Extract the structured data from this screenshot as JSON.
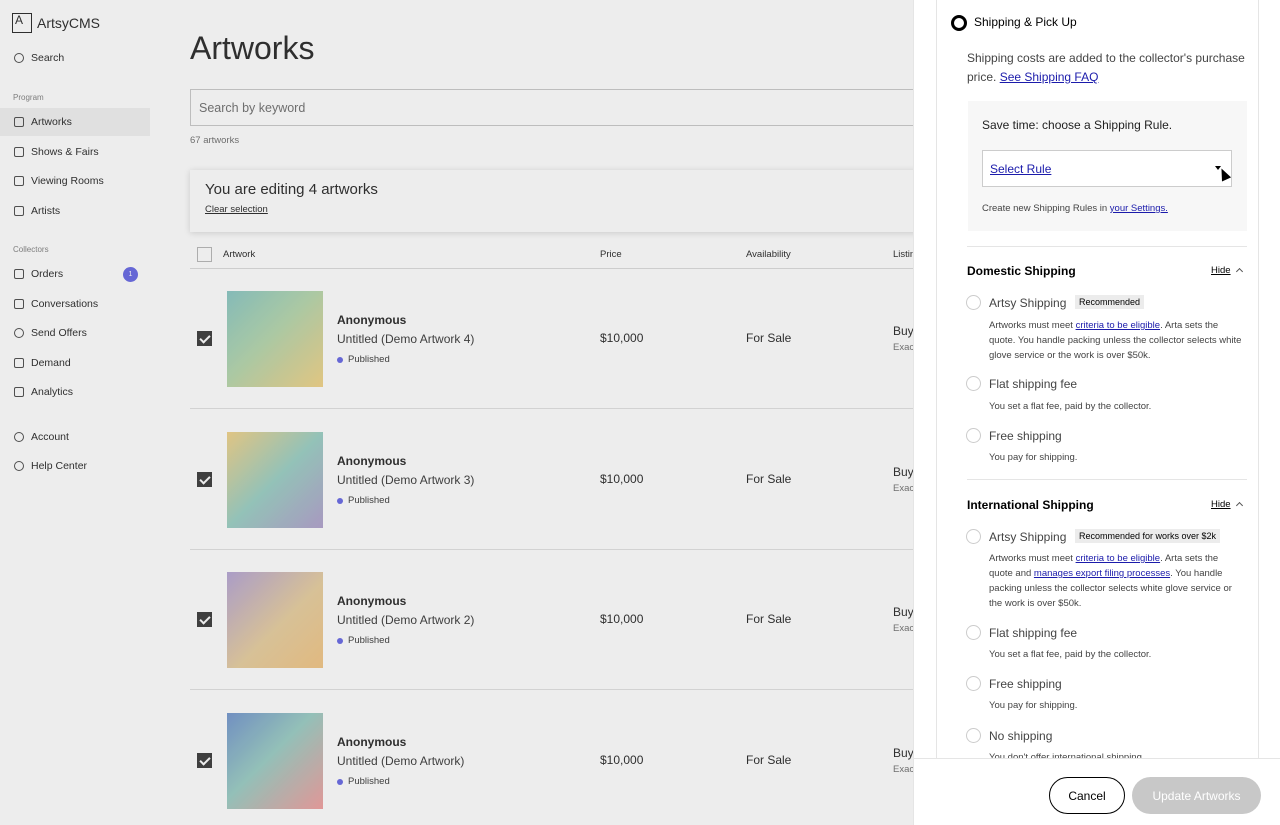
{
  "app": {
    "logo_text": "ArtsyCMS",
    "sidebar": {
      "search": "Search",
      "program_label": "Program",
      "program_items": [
        "Artworks",
        "Shows & Fairs",
        "Viewing Rooms",
        "Artists"
      ],
      "collectors_label": "Collectors",
      "collector_items": [
        "Orders",
        "Conversations",
        "Send Offers",
        "Demand",
        "Analytics"
      ],
      "orders_badge": "1",
      "footer_items": [
        "Account",
        "Help Center"
      ]
    },
    "page_title": "Artworks",
    "search_placeholder": "Search by keyword",
    "artwork_count": "67 artworks",
    "edit_banner": {
      "title": "You are editing 4 artworks",
      "clear": "Clear selection"
    },
    "table_headers": {
      "artwork": "Artwork",
      "price": "Price",
      "availability": "Availability",
      "listing": "Listin"
    },
    "rows": [
      {
        "artist": "Anonymous",
        "title": "Untitled (Demo Artwork 4)",
        "status": "Published",
        "price": "$10,000",
        "availability": "For Sale",
        "listing": "Buy",
        "listing_sub": "Exac",
        "checked": true
      },
      {
        "artist": "Anonymous",
        "title": "Untitled (Demo Artwork 3)",
        "status": "Published",
        "price": "$10,000",
        "availability": "For Sale",
        "listing": "Buy",
        "listing_sub": "Exac",
        "checked": true
      },
      {
        "artist": "Anonymous",
        "title": "Untitled (Demo Artwork 2)",
        "status": "Published",
        "price": "$10,000",
        "availability": "For Sale",
        "listing": "Buy",
        "listing_sub": "Exac",
        "checked": true
      },
      {
        "artist": "Anonymous",
        "title": "Untitled (Demo Artwork)",
        "status": "Published",
        "price": "$10,000",
        "availability": "For Sale",
        "listing": "Buy",
        "listing_sub": "Exac",
        "checked": true
      }
    ]
  },
  "panel": {
    "section_title": "Shipping & Pick Up",
    "intro": "Shipping costs are added to the collector's purchase price.",
    "intro_link": "See Shipping FAQ",
    "rule_box": {
      "title": "Save time: choose a Shipping Rule.",
      "select_value": "Select Rule",
      "note_prefix": "Create new Shipping Rules in",
      "note_link": "your Settings."
    },
    "domestic": {
      "title": "Domestic Shipping",
      "hide": "Hide",
      "options": [
        {
          "label": "Artsy Shipping",
          "tag": "Recommended",
          "desc_a": "Artworks must meet",
          "desc_link": "criteria to be eligible",
          "desc_b": ". Arta sets the quote. You handle packing unless the collector selects white glove service or the work is over $50k."
        },
        {
          "label": "Flat shipping fee",
          "desc": "You set a flat fee, paid by the collector."
        },
        {
          "label": "Free shipping",
          "desc": "You pay for shipping."
        }
      ]
    },
    "international": {
      "title": "International Shipping",
      "hide": "Hide",
      "options": [
        {
          "label": "Artsy Shipping",
          "tag": "Recommended for works over $2k",
          "desc_a": "Artworks must meet",
          "desc_link": "criteria to be eligible",
          "desc_b": ". Arta sets the quote and",
          "desc_link2": "manages export filing processes",
          "desc_c": ". You handle packing unless the collector selects white glove service or the work is over $50k."
        },
        {
          "label": "Flat shipping fee",
          "desc": "You set a flat fee, paid by the collector."
        },
        {
          "label": "Free shipping",
          "desc": "You pay for shipping."
        },
        {
          "label": "No shipping",
          "desc": "You don't offer international shipping."
        }
      ]
    },
    "cancel": "Cancel",
    "update": "Update Artworks"
  },
  "colors": {
    "accent": "#6e6fe6",
    "link": "#1b1bab",
    "disabled_button": "#c8c8c8"
  }
}
